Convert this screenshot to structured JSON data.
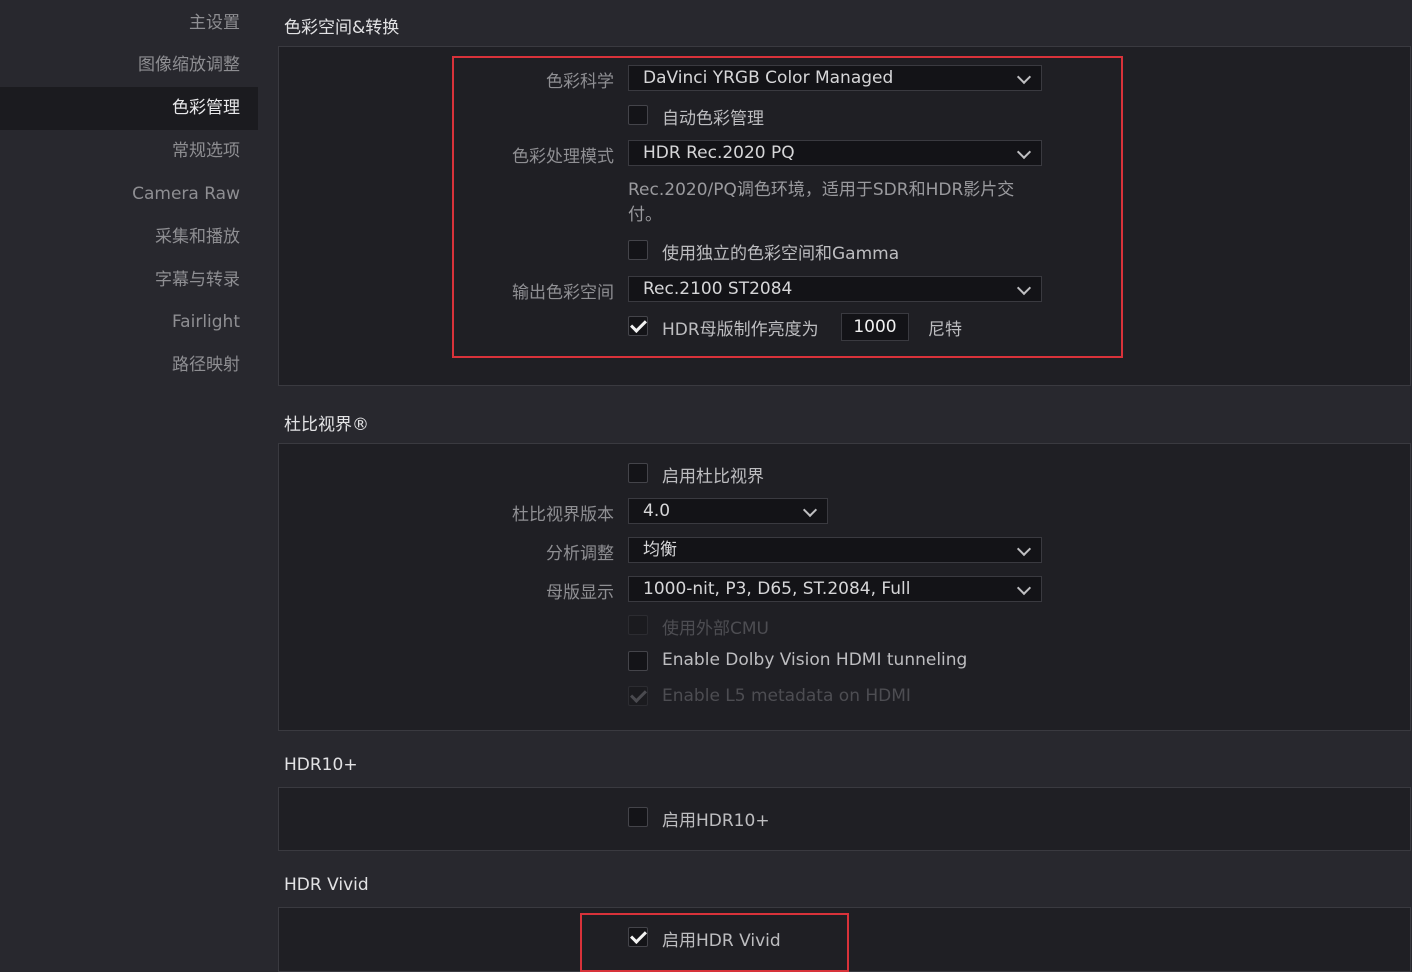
{
  "sidebar": {
    "items": [
      {
        "label": "主设置"
      },
      {
        "label": "图像缩放调整"
      },
      {
        "label": "色彩管理"
      },
      {
        "label": "常规选项"
      },
      {
        "label": "Camera Raw"
      },
      {
        "label": "采集和播放"
      },
      {
        "label": "字幕与转录"
      },
      {
        "label": "Fairlight"
      },
      {
        "label": "路径映射"
      }
    ],
    "active_item": "色彩管理"
  },
  "color_space": {
    "title": "色彩空间&转换",
    "color_science_label": "色彩科学",
    "color_science_value": "DaVinci YRGB Color Managed",
    "auto_color_mgmt": {
      "label": "自动色彩管理",
      "checked": false
    },
    "processing_mode_label": "色彩处理模式",
    "processing_mode_value": "HDR Rec.2020 PQ",
    "processing_mode_desc": "Rec.2020/PQ调色环境，适用于SDR和HDR影片交付。",
    "separate_gamma": {
      "label": "使用独立的色彩空间和Gamma",
      "checked": false
    },
    "output_space_label": "输出色彩空间",
    "output_space_value": "Rec.2100 ST2084",
    "hdr_mastering": {
      "label": "HDR母版制作亮度为",
      "checked": true,
      "value": "1000",
      "unit": "尼特"
    }
  },
  "dolby": {
    "title": "杜比视界®",
    "enable": {
      "label": "启用杜比视界",
      "checked": false
    },
    "version_label": "杜比视界版本",
    "version_value": "4.0",
    "analysis_label": "分析调整",
    "analysis_value": "均衡",
    "master_display_label": "母版显示",
    "master_display_value": "1000-nit, P3, D65, ST.2084, Full",
    "external_cmu": {
      "label": "使用外部CMU",
      "checked": false,
      "disabled": true
    },
    "hdmi_tunneling": {
      "label": "Enable Dolby Vision HDMI tunneling",
      "checked": false
    },
    "l5_metadata": {
      "label": "Enable L5 metadata on HDMI",
      "checked": true,
      "disabled": true
    }
  },
  "hdr10plus": {
    "title": "HDR10+",
    "enable": {
      "label": "启用HDR10+",
      "checked": false
    }
  },
  "hdr_vivid": {
    "title": "HDR Vivid",
    "enable": {
      "label": "启用HDR Vivid",
      "checked": true
    }
  },
  "colors": {
    "highlight": "#d8323a",
    "background": "#28282e",
    "panel": "#1f1f24"
  }
}
